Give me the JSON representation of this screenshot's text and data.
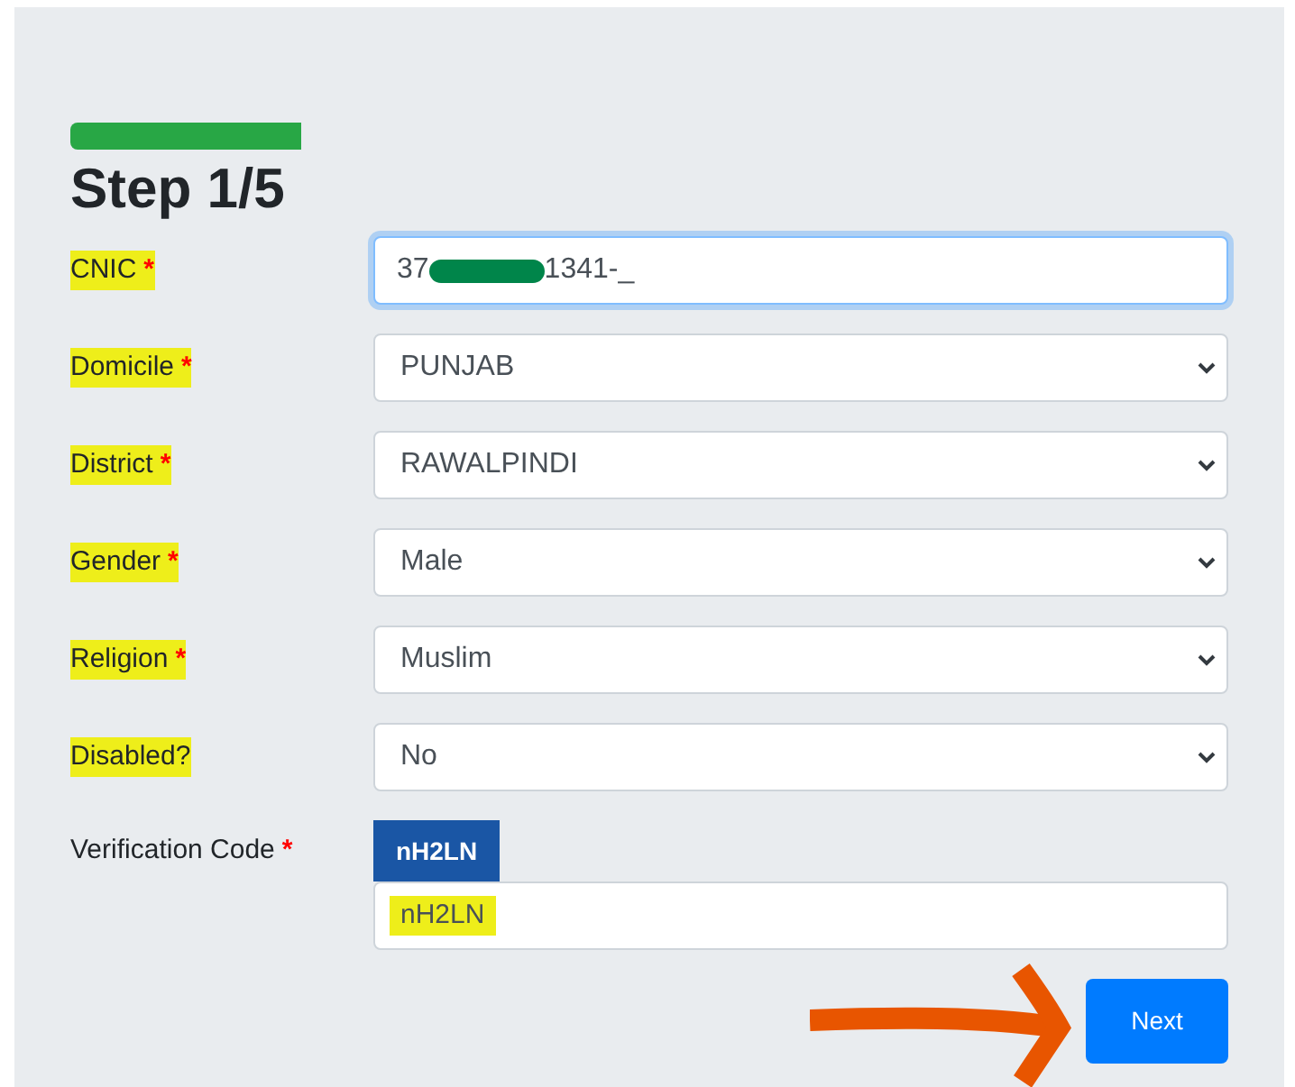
{
  "heading": "Step 1/5",
  "fields": [
    {
      "kind": "text",
      "label": "CNIC",
      "asterisk": "*",
      "highlighted": true,
      "focused": true,
      "value_start": "37",
      "value_end": "1341-_",
      "redacted": true
    },
    {
      "kind": "select",
      "label": "Domicile",
      "asterisk": "*",
      "highlighted": true,
      "value": "PUNJAB"
    },
    {
      "kind": "select",
      "label": "District",
      "asterisk": "*",
      "highlighted": true,
      "value": "RAWALPINDI"
    },
    {
      "kind": "select",
      "label": "Gender",
      "asterisk": "*",
      "highlighted": true,
      "value": "Male"
    },
    {
      "kind": "select",
      "label": "Religion",
      "asterisk": "*",
      "highlighted": true,
      "value": "Muslim"
    },
    {
      "kind": "select",
      "label": "Disabled?",
      "highlighted": true,
      "value": "No"
    },
    {
      "kind": "captcha",
      "label": "Verification Code",
      "asterisk": "*",
      "highlighted": false,
      "captcha": "nH2LN",
      "value": "nH2LN",
      "value_highlighted": true
    }
  ],
  "next_button": "Next"
}
